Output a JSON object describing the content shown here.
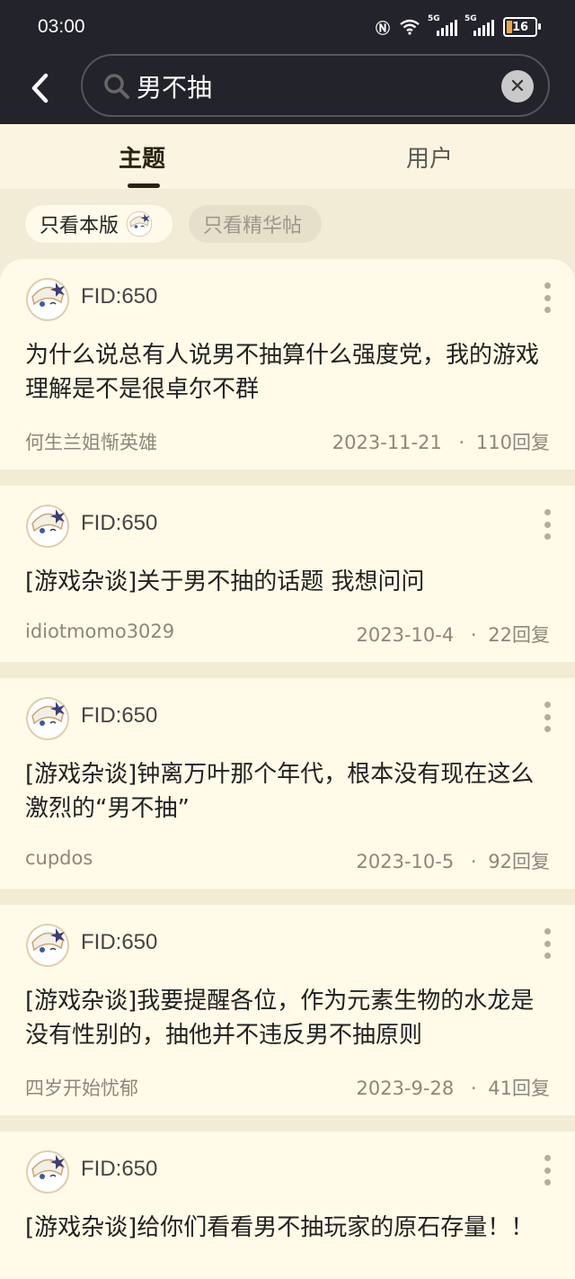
{
  "status_bar": {
    "time": "03:00",
    "battery": "16",
    "network1": "5G",
    "network2": "5G"
  },
  "search": {
    "query": "男不抽",
    "search_icon": "search-icon",
    "clear_icon": "close-icon",
    "back_icon": "chevron-left-icon"
  },
  "tabs": [
    {
      "label": "主题"
    },
    {
      "label": "用户"
    }
  ],
  "filters": [
    {
      "label": "只看本版"
    },
    {
      "label": "只看精华帖"
    }
  ],
  "posts": [
    {
      "fid": "FID:650",
      "title": "为什么说总有人说男不抽算什么强度党，我的游戏理解是不是很卓尔不群",
      "author": "何生兰姐惭英雄",
      "date": "2023-11-21",
      "replies": "110回复"
    },
    {
      "fid": "FID:650",
      "title": "[游戏杂谈]关于男不抽的话题 我想问问",
      "author": "idiotmomo3029",
      "date": "2023-10-4",
      "replies": "22回复"
    },
    {
      "fid": "FID:650",
      "title": "[游戏杂谈]钟离万叶那个年代，根本没有现在这么激烈的“男不抽”",
      "author": "cupdos",
      "date": "2023-10-5",
      "replies": "92回复"
    },
    {
      "fid": "FID:650",
      "title": "[游戏杂谈]我要提醒各位，作为元素生物的水龙是没有性别的，抽他并不违反男不抽原则",
      "author": "四岁开始忧郁",
      "date": "2023-9-28",
      "replies": "41回复"
    },
    {
      "fid": "FID:650",
      "title": "[游戏杂谈]给你们看看男不抽玩家的原石存量！！",
      "author": "",
      "date": "",
      "replies": ""
    }
  ],
  "colors": {
    "header_bg": "#23232b",
    "page_bg": "#f2ebd5",
    "card_bg": "#fffbe8",
    "accent": "#f2a533"
  }
}
